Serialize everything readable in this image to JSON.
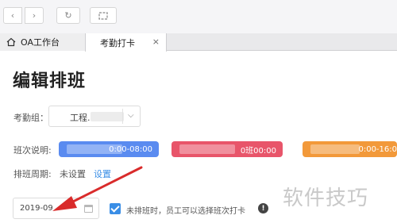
{
  "browser": {
    "back_glyph": "‹",
    "forward_glyph": "›",
    "reload_glyph": "↻",
    "tabs": [
      {
        "label": "OA工作台",
        "active": false
      },
      {
        "label": "考勤打卡",
        "active": true,
        "close": "×"
      }
    ]
  },
  "page": {
    "title": "编辑排班",
    "attendance_group": {
      "label": "考勤组：",
      "value": "工程."
    },
    "shifts": {
      "label": "班次说明:",
      "items": [
        {
          "text": "0:00-08:00",
          "color": "#5a8bf0"
        },
        {
          "text": "0班00:00",
          "color": "#e8556a"
        },
        {
          "text": "0:00-16:0",
          "color": "#f2993a"
        }
      ]
    },
    "cycle": {
      "label": "排班周期:",
      "value": "未设置",
      "link": "设置"
    },
    "month": {
      "value": "2019-09"
    },
    "checkbox": {
      "checked": true,
      "label": "未排班时，员工可以选择班次打卡"
    },
    "info_glyph": "!"
  },
  "watermark": "软件技巧",
  "colors": {
    "accent": "#3a8ee6",
    "annotation_arrow": "#d92b2b"
  }
}
